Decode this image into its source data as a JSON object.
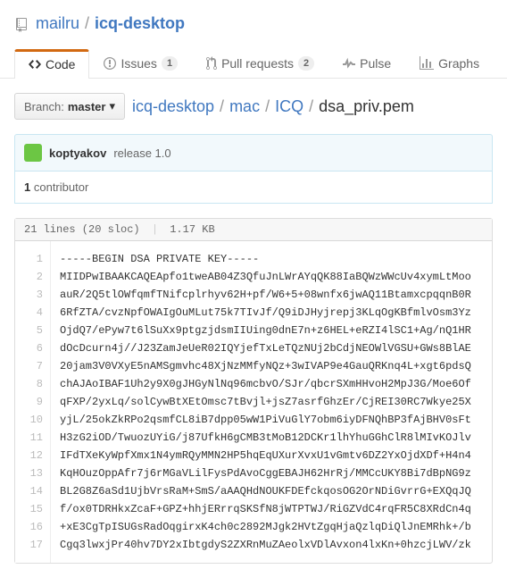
{
  "repo": {
    "owner": "mailru",
    "name": "icq-desktop"
  },
  "tabs": {
    "code": {
      "label": "Code"
    },
    "issues": {
      "label": "Issues",
      "count": "1"
    },
    "pulls": {
      "label": "Pull requests",
      "count": "2"
    },
    "pulse": {
      "label": "Pulse"
    },
    "graphs": {
      "label": "Graphs"
    }
  },
  "branch": {
    "prefix": "Branch:",
    "name": "master"
  },
  "breadcrumb": {
    "root": "icq-desktop",
    "p1": "mac",
    "p2": "ICQ",
    "file": "dsa_priv.pem"
  },
  "commit": {
    "author": "koptyakov",
    "message": "release 1.0"
  },
  "contributors": {
    "count": "1",
    "label": "contributor"
  },
  "file_info": {
    "lines": "21 lines (20 sloc)",
    "size": "1.17 KB"
  },
  "code_lines": [
    "-----BEGIN DSA PRIVATE KEY-----",
    "MIIDPwIBAAKCAQEApfo1tweAB04Z3QfuJnLWrAYqQK88IaBQWzWWcUv4xymLtMoo",
    "auR/2Q5tlOWfqmfTNifcplrhyv62H+pf/W6+5+08wnfx6jwAQ11BtamxcpqqnB0R",
    "6RfZTA/cvzNpfOWAIgOuMLut75k7TIvJf/Q9iDJHyjrepj3KLqOgKBfmlvOsm3Yz",
    "OjdQ7/ePyw7t6lSuXx9ptgzjdsmIIUing0dnE7n+z6HEL+eRZI4lSC1+Ag/nQ1HR",
    "dOcDcurn4j//J23ZamJeUeR02IQYjefTxLeTQzNUj2bCdjNEOWlVGSU+GWs8BlAE",
    "20jam3V0VXyE5nAMSgmvhc48XjNzMMfyNQz+3wIVAP9e4GauQRKnq4L+xgt6pdsQ",
    "chAJAoIBAF1Uh2y9X0gJHGyNlNq96mcbvO/SJr/qbcrSXmHHvoH2MpJ3G/Moe6Of",
    "qFXP/2yxLq/solCywBtXEtOmsc7tBvjl+jsZ7asrfGhzEr/CjREI30RC7Wkye25X",
    "yjL/25okZkRPo2qsmfCL8iB7dpp05wW1PiVuGlY7obm6iyDFNQhBP3fAjBHV0sFt",
    "H3zG2iOD/TwuozUYiG/j87UfkH6gCMB3tMoB12DCKr1lhYhuGGhClR8lMIvKOJlv",
    "IFdTXeKyWpfXmx1N4ymRQyMMN2HP5hqEqUXurXvxU1vGmtv6DZ2YxOjdXDf+H4n4",
    "KqHOuzOppAfr7j6rMGaVLilFysPdAvoCggEBAJH62HrRj/MMCcUKY8Bi7dBpNG9z",
    "BL2G8Z6aSd1UjbVrsRaM+SmS/aAAQHdNOUKFDEfckqosOG2OrNDiGvrrG+EXQqJQ",
    "f/ox0TDRHkxZcaF+GPZ+hhjERrrqSKSfN8jWTPTWJ/RiGZVdC4rqFR5C8XRdCn4q",
    "+xE3CgTpISUGsRadOqgirxK4ch0c2892MJgk2HVtZgqHjaQzlqDiQlJnEMRhk+/b",
    "Cgq3lwxjPr40hv7DY2xIbtgdyS2ZXRnMuZAeolxVDlAvxon4lxKn+0hzcjLWV/zk"
  ]
}
